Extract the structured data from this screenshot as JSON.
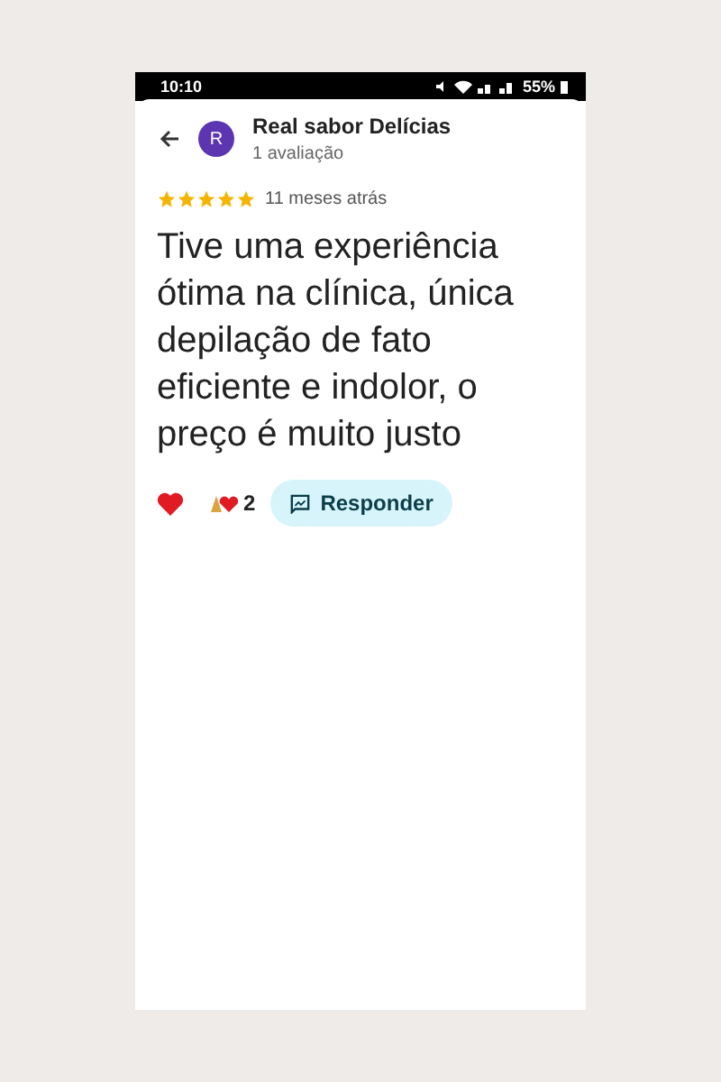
{
  "status_bar": {
    "time": "10:10",
    "battery": "55%"
  },
  "header": {
    "avatar_letter": "R",
    "name": "Real sabor Delícias",
    "subtitle": "1 avaliação"
  },
  "review": {
    "stars": 5,
    "time": "11 meses atrás",
    "text": "Tive uma experiência ótima na clínica, única depilação de fato eficiente e indolor, o preço é muito justo"
  },
  "reactions": {
    "count": "2",
    "reply_button": "Responder"
  }
}
